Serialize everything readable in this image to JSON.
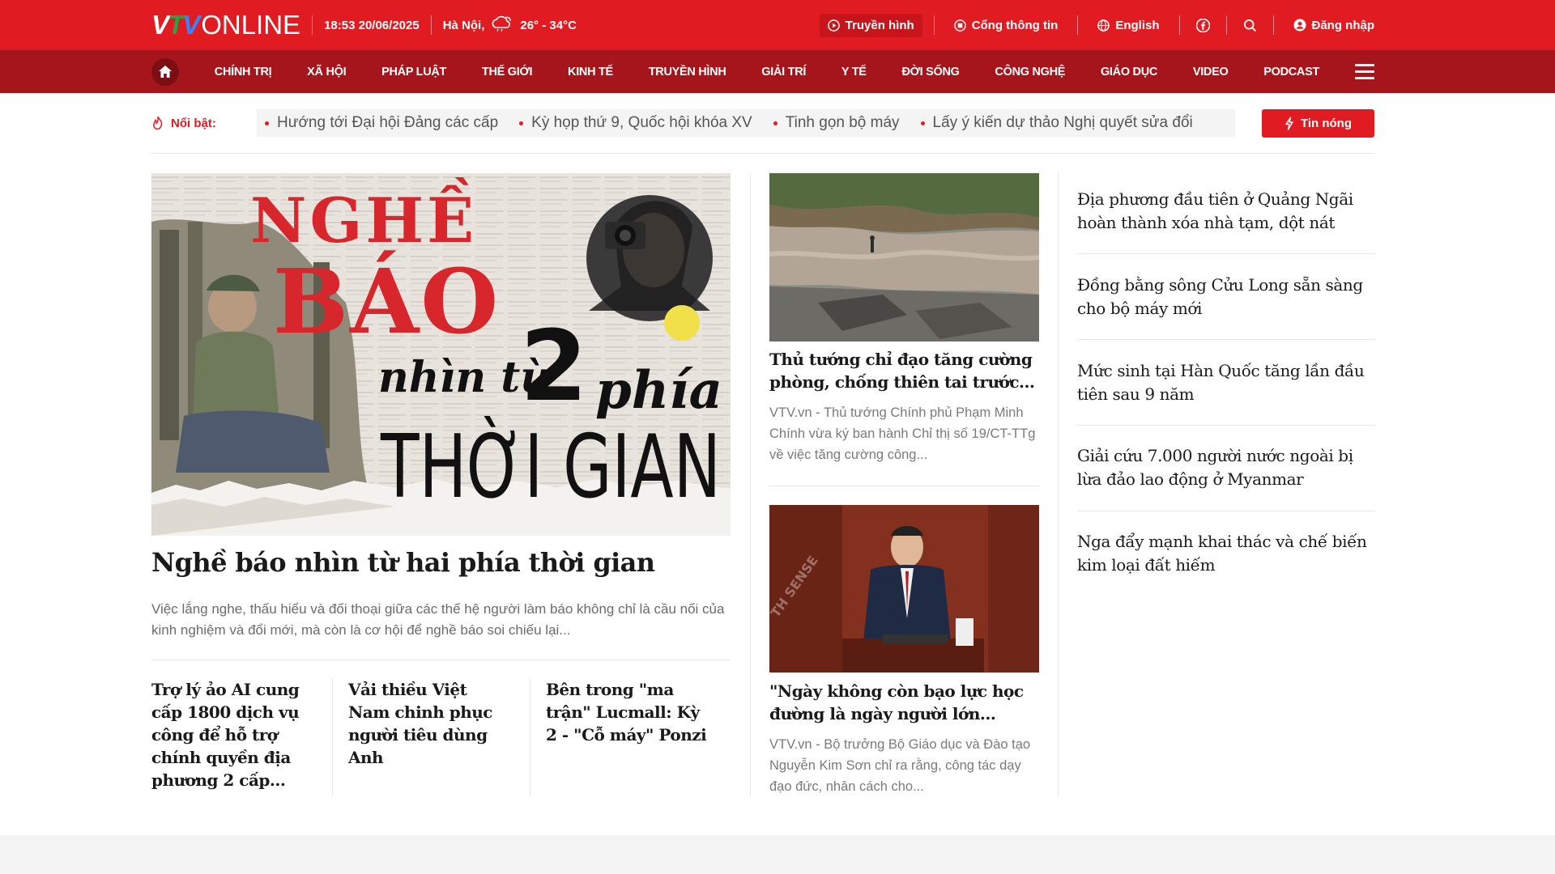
{
  "topbar": {
    "logo_vtv": [
      "V",
      "T",
      "V"
    ],
    "logo_online": "ONLINE",
    "datetime": "18:53 20/06/2025",
    "location": "Hà Nội,",
    "temperature": "26° - 34°C",
    "links": {
      "tv": "Truyền hình",
      "portal": "Cổng thông tin",
      "english": "English",
      "login": "Đăng nhập"
    },
    "brand_color": "#e11b22",
    "icons": [
      "tv-icon",
      "portal-icon",
      "globe-icon",
      "facebook-icon",
      "search-icon",
      "user-icon"
    ]
  },
  "nav": {
    "items": [
      "CHÍNH TRỊ",
      "XÃ HỘI",
      "PHÁP LUẬT",
      "THẾ GIỚI",
      "KINH TẾ",
      "TRUYỀN HÌNH",
      "GIẢI TRÍ",
      "Y TẾ",
      "ĐỜI SỐNG",
      "CÔNG NGHỆ",
      "GIÁO DỤC",
      "VIDEO",
      "PODCAST"
    ],
    "bg_color": "#a5151b"
  },
  "highlight": {
    "label": "Nổi bật:",
    "items": [
      "Hướng tới Đại hội Đảng các cấp",
      "Kỳ họp thứ 9, Quốc hội khóa XV",
      "Tinh gọn bộ máy",
      "Lấy ý kiến dự thảo Nghị quyết sửa đổi"
    ],
    "hot_button": "Tin nóng"
  },
  "featured": {
    "image_text": {
      "line1": "NGHỀ",
      "line2": "BÁO",
      "line3": "nhìn từ",
      "line4": "2",
      "line5": "phía",
      "line6": "THỜI GIAN"
    },
    "title": "Nghề báo nhìn từ hai phía thời gian",
    "sapo": "Việc lắng nghe, thấu hiểu và đối thoại giữa các thế hệ người làm báo không chỉ là cầu nối của kinh nghiệm và đổi mới, mà còn là cơ hội để nghề báo soi chiếu lại..."
  },
  "sub_stories": [
    "Trợ lý ảo AI cung cấp 1800 dịch vụ công để hỗ trợ chính quyền địa phương 2 cấp...",
    "Vải thiều Việt Nam chinh phục người tiêu dùng Anh",
    "Bên trong \"ma trận\" Lucmall: Kỳ 2 - \"Cỗ máy\" Ponzi"
  ],
  "middle_stories": [
    {
      "title": "Thủ tướng chỉ đạo tăng cường phòng, chống thiên tai trước...",
      "sapo": "VTV.vn - Thủ tướng Chính phủ Phạm Minh Chính vừa ký ban hành Chỉ thị số 19/CT-TTg về việc tăng cường công..."
    },
    {
      "title": "\"Ngày không còn bạo lực học đường là ngày người lớn...",
      "sapo": "VTV.vn - Bộ trưởng Bộ Giáo dục và Đào tạo Nguyễn Kim Sơn chỉ ra rằng, công tác dạy đạo đức, nhân cách cho...",
      "watermark": "TH SENSE"
    }
  ],
  "right_stories": [
    "Địa phương đầu tiên ở Quảng Ngãi hoàn thành xóa nhà tạm, dột nát",
    "Đồng bằng sông Cửu Long sẵn sàng cho bộ máy mới",
    "Mức sinh tại Hàn Quốc tăng lần đầu tiên sau 9 năm",
    "Giải cứu 7.000 người nước ngoài bị lừa đảo lao động ở Myanmar",
    "Nga đẩy mạnh khai thác và chế biến kim loại đất hiếm"
  ]
}
